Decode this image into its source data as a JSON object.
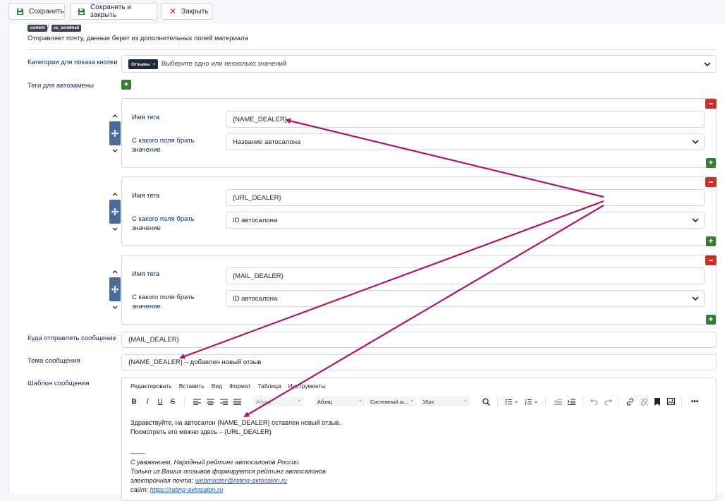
{
  "toolbar": {
    "save": "Сохранить",
    "save_close": "Сохранить и закрыть",
    "close": "Закрыть"
  },
  "header": {
    "badges": [
      "content",
      "cs_sendmail"
    ],
    "badge_sep": "/",
    "description": "Отправляет почту, данные берет из дополнительных полей материала"
  },
  "categories": {
    "label": "Категории для показа кнопки",
    "chip": "Отзывы",
    "chip_remove": "×",
    "placeholder": "Выберите одно или несколько значений"
  },
  "tags": {
    "label": "Теги для автозамены",
    "name_label": "Имя тега",
    "field_label_line1": "С какого поля брать",
    "field_label_line2": "значение",
    "items": [
      {
        "name": "{NAME_DEALER}",
        "field": "Название автосалона"
      },
      {
        "name": "{URL_DEALER}",
        "field": "ID автосалона"
      },
      {
        "name": "{MAIL_DEALER}",
        "field": "ID автосалона"
      }
    ]
  },
  "send_to": {
    "label": "Куда отправлять сообщение",
    "value": "{MAIL_DEALER}"
  },
  "subject": {
    "label": "Тема сообщения",
    "value": "{NAME_DEALER} – добавлен новый отзыв"
  },
  "template": {
    "label": "Шаблон сообщения",
    "menu": [
      "Редактировать",
      "Вставить",
      "Вид",
      "Формат",
      "Таблица",
      "Инструменты"
    ],
    "font_select": "Абзац",
    "block_select": "Абзац",
    "family_select": "Системный ш...",
    "size_select": "16px",
    "body": {
      "line1": "Здравствуйте, на автосалон {NAME_DEALER} оставлен новый отзыв.",
      "line2": "Посмотреть его можно здесь – {URL_DEALER}",
      "rule": "____",
      "sig1": "С уважением, Народный рейтинг автосалонов России",
      "sig2": "Только из Ваших отзывов формируется рейтинг автосалонов",
      "email_prefix": "электронная почта: ",
      "email": "webmaster@rating-avtosalon.ru",
      "site_prefix": "сайт: ",
      "site": "https://rating-avtosalon.ru"
    }
  },
  "colors": {
    "annotation_arrow": "#b0136f",
    "danger": "#c9302c",
    "success": "#3c7a3a",
    "drag": "#4b6b9a",
    "label": "#0a2a5e"
  }
}
